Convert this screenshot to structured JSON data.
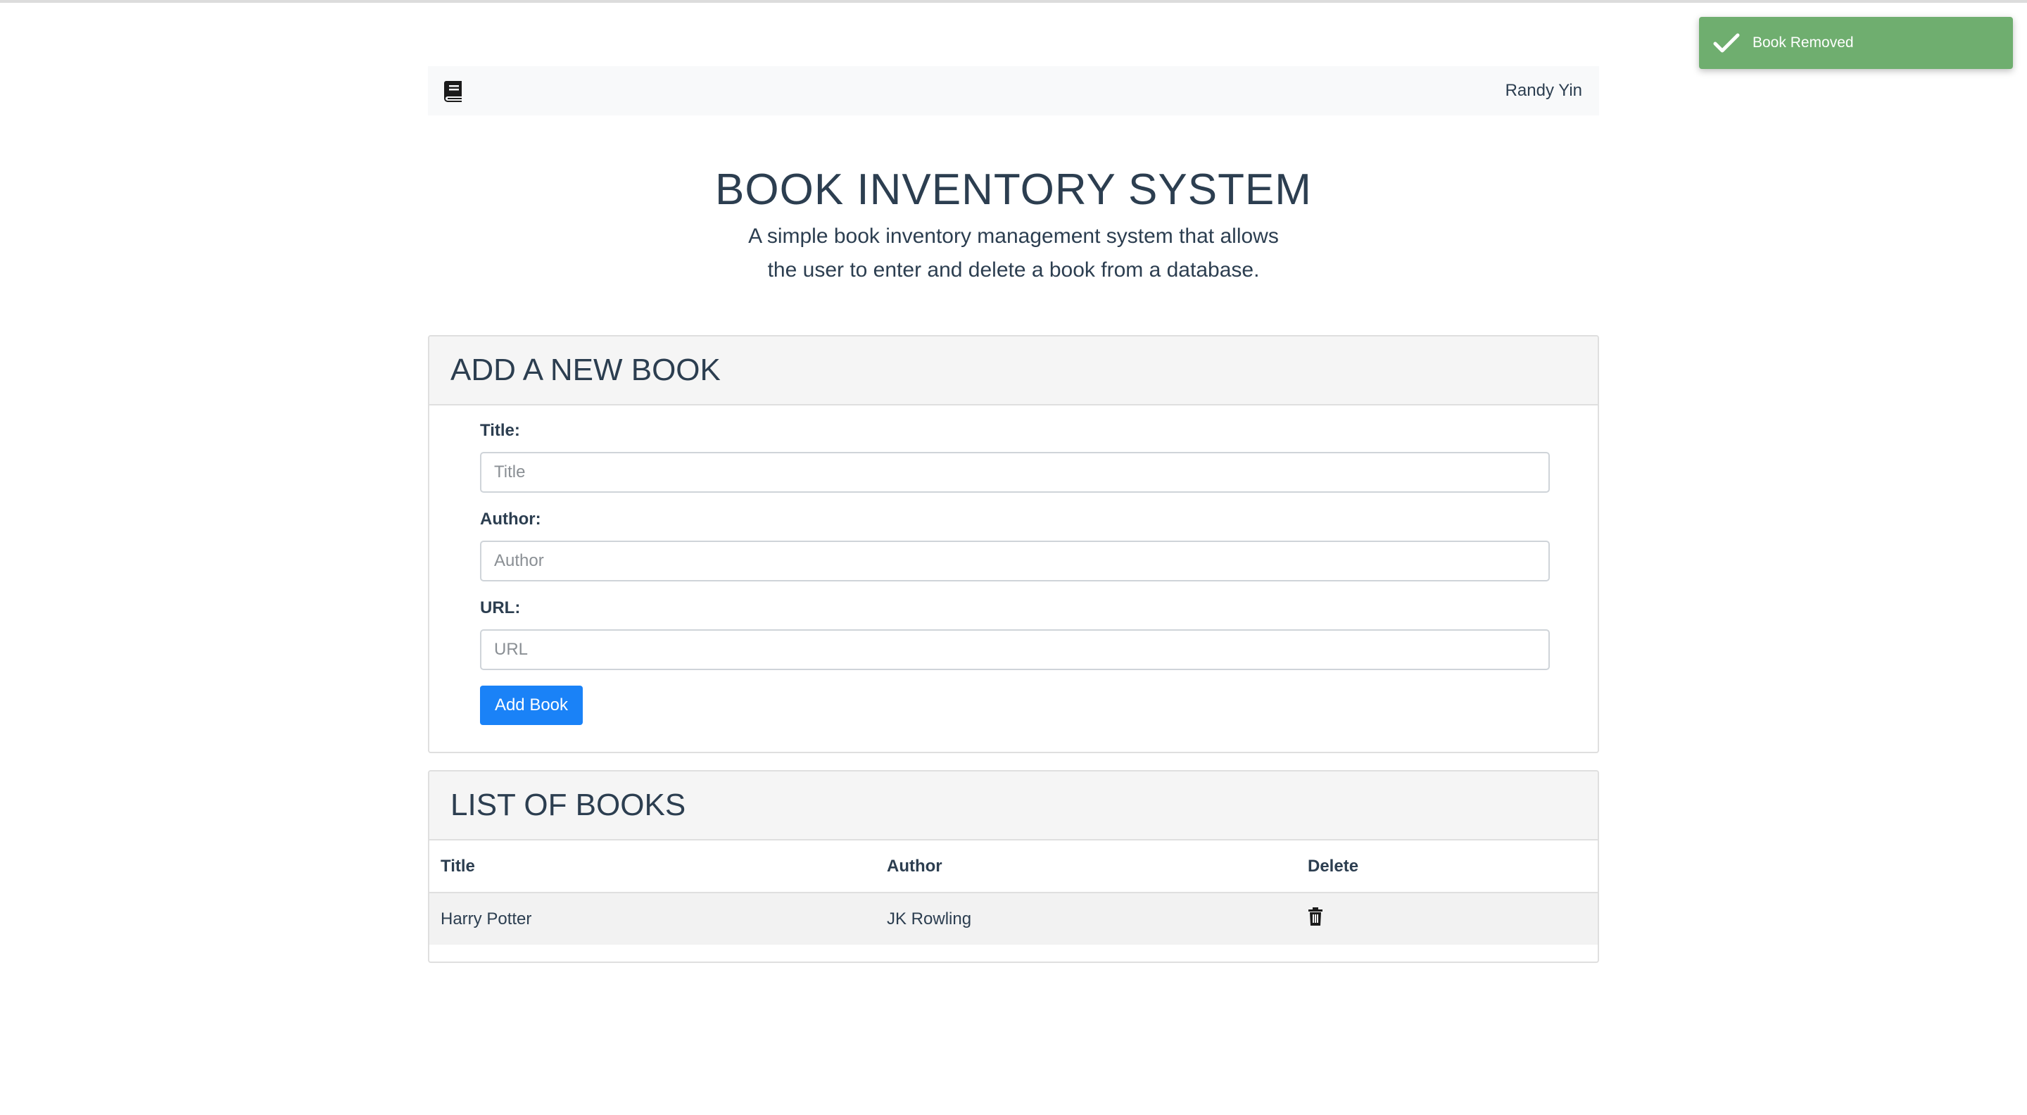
{
  "toast": {
    "icon": "checkmark-icon",
    "message": "Book Removed",
    "color": "#6fae6f"
  },
  "navbar": {
    "brand_icon": "book-icon",
    "username": "Randy Yin"
  },
  "hero": {
    "title": "BOOK INVENTORY SYSTEM",
    "subtitle": "A simple book inventory management system that allows the user to enter and delete a book from a database."
  },
  "add_book": {
    "heading": "ADD A NEW BOOK",
    "fields": [
      {
        "label": "Title:",
        "placeholder": "Title",
        "value": ""
      },
      {
        "label": "Author:",
        "placeholder": "Author",
        "value": ""
      },
      {
        "label": "URL:",
        "placeholder": "URL",
        "value": ""
      }
    ],
    "submit_label": "Add Book",
    "accent": "#1a82f7"
  },
  "book_list": {
    "heading": "LIST OF BOOKS",
    "columns": [
      "Title",
      "Author",
      "Delete"
    ],
    "rows": [
      {
        "title": "Harry Potter",
        "author": "JK Rowling",
        "delete_icon": "trash-icon"
      }
    ]
  }
}
